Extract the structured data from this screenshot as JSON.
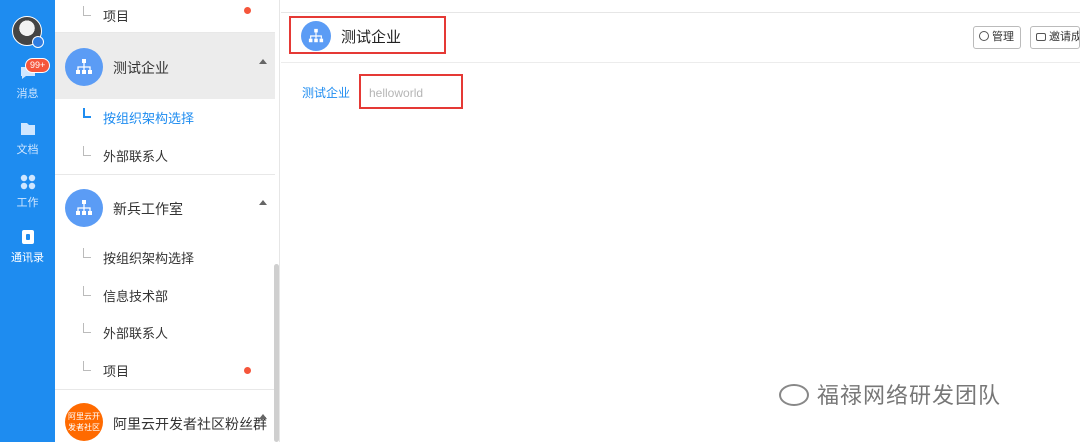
{
  "rail": {
    "badge": "99+",
    "items": [
      {
        "label": "消息"
      },
      {
        "label": "文档"
      },
      {
        "label": "工作"
      },
      {
        "label": "通讯录"
      }
    ]
  },
  "panel": {
    "top_sub": "项目",
    "orgs": [
      {
        "name": "测试企业",
        "subs": [
          "按组织架构选择",
          "外部联系人"
        ]
      },
      {
        "name": "新兵工作室",
        "subs": [
          "按组织架构选择",
          "信息技术部",
          "外部联系人",
          "项目"
        ]
      },
      {
        "name": "阿里云开发者社区粉丝群",
        "logo_text": "阿里云开发者社区"
      }
    ]
  },
  "main": {
    "title": "测试企业",
    "buttons": {
      "manage": "管理",
      "invite": "邀请成员"
    },
    "breadcrumb": "测试企业",
    "input_placeholder": "helloworld",
    "watermark": "福禄网络研发团队"
  }
}
